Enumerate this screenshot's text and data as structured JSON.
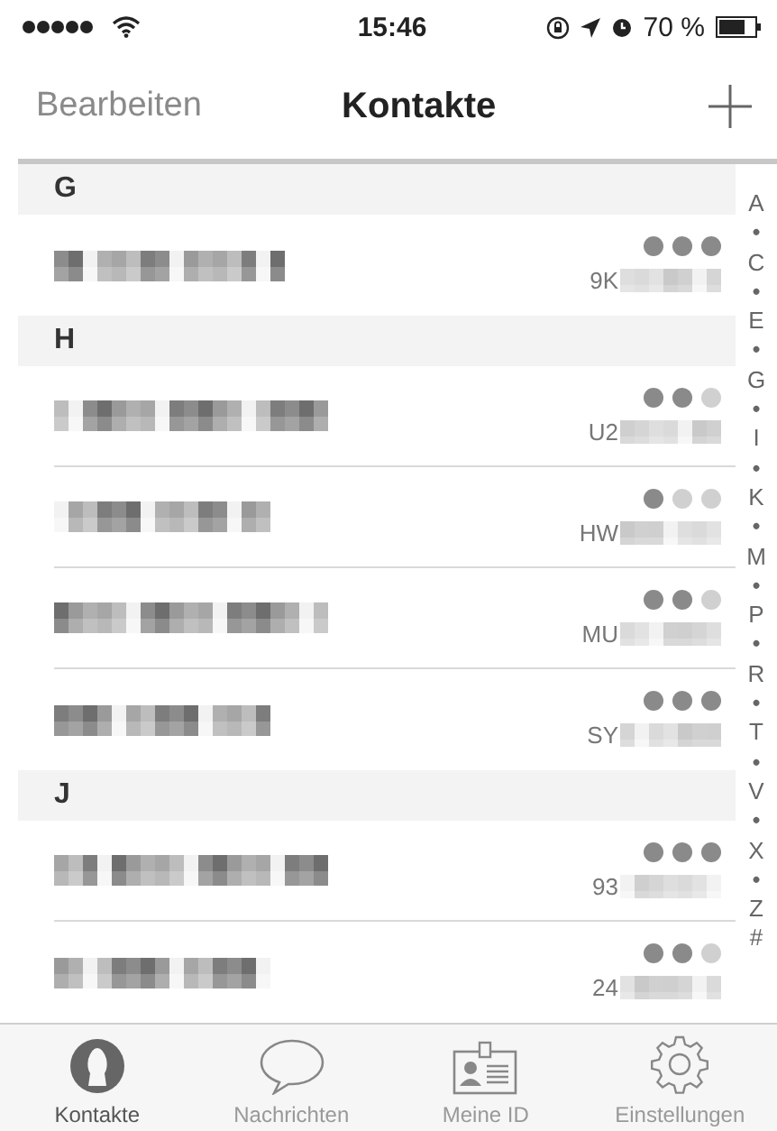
{
  "status_bar": {
    "time": "15:46",
    "battery": "70 %"
  },
  "nav_bar": {
    "left": "Bearbeiten",
    "title": "Kontakte"
  },
  "sections": [
    {
      "letter": "G",
      "contacts": [
        {
          "id_prefix": "9K",
          "stars": 3
        }
      ]
    },
    {
      "letter": "H",
      "contacts": [
        {
          "id_prefix": "U2",
          "stars": 2
        },
        {
          "id_prefix": "HW",
          "stars": 1
        },
        {
          "id_prefix": "MU",
          "stars": 2
        },
        {
          "id_prefix": "SY",
          "stars": 3
        }
      ]
    },
    {
      "letter": "J",
      "contacts": [
        {
          "id_prefix": "93",
          "stars": 3
        },
        {
          "id_prefix": "24",
          "stars": 2
        }
      ]
    }
  ],
  "index": [
    "A",
    "•",
    "C",
    "•",
    "E",
    "•",
    "G",
    "•",
    "I",
    "•",
    "K",
    "•",
    "M",
    "•",
    "P",
    "•",
    "R",
    "•",
    "T",
    "•",
    "V",
    "•",
    "X",
    "•",
    "Z",
    "#"
  ],
  "tabs": [
    {
      "label": "Kontakte",
      "kind": "contacts",
      "selected": true
    },
    {
      "label": "Nachrichten",
      "kind": "messages",
      "selected": false
    },
    {
      "label": "Meine ID",
      "kind": "id",
      "selected": false
    },
    {
      "label": "Einstellungen",
      "kind": "settings",
      "selected": false
    }
  ]
}
